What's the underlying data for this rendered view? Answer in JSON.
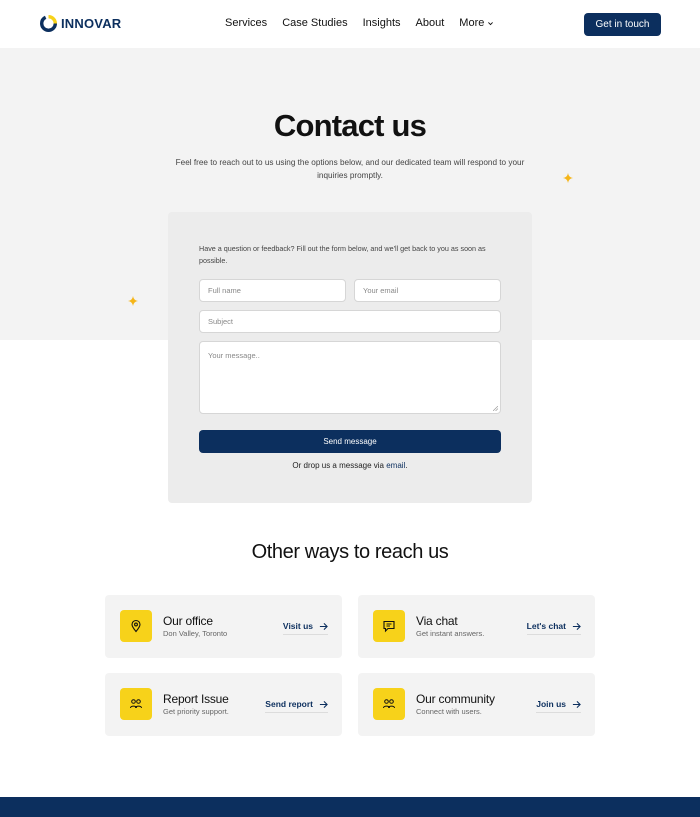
{
  "brand": {
    "name": "INNOVAR",
    "accent": "#0c2f5e",
    "highlight": "#f7d21a"
  },
  "nav": {
    "items": [
      "Services",
      "Case Studies",
      "Insights",
      "About",
      "More"
    ],
    "cta_label": "Get in touch"
  },
  "hero": {
    "title": "Contact us",
    "subtitle": "Feel free to reach out to us using the options below, and our dedicated team will respond to your inquiries promptly."
  },
  "form": {
    "intro": "Have a question or feedback? Fill out the form below, and we'll get back to you as soon as possible.",
    "name_placeholder": "Full name",
    "email_placeholder": "Your email",
    "subject_placeholder": "Subject",
    "message_placeholder": "Your message..",
    "submit_label": "Send message",
    "drop_prefix": "Or drop us a message via ",
    "drop_link": "email",
    "drop_suffix": "."
  },
  "other": {
    "title": "Other ways to reach us",
    "cards": [
      {
        "title": "Our office",
        "subtitle": "Don Valley, Toronto",
        "link": "Visit us",
        "icon": "location-pin-icon"
      },
      {
        "title": "Via chat",
        "subtitle": "Get instant answers.",
        "link": "Let's chat",
        "icon": "chat-icon"
      },
      {
        "title": "Report Issue",
        "subtitle": "Get priority support.",
        "link": "Send report",
        "icon": "users-icon"
      },
      {
        "title": "Our community",
        "subtitle": "Connect with users.",
        "link": "Join us",
        "icon": "community-icon"
      }
    ]
  }
}
